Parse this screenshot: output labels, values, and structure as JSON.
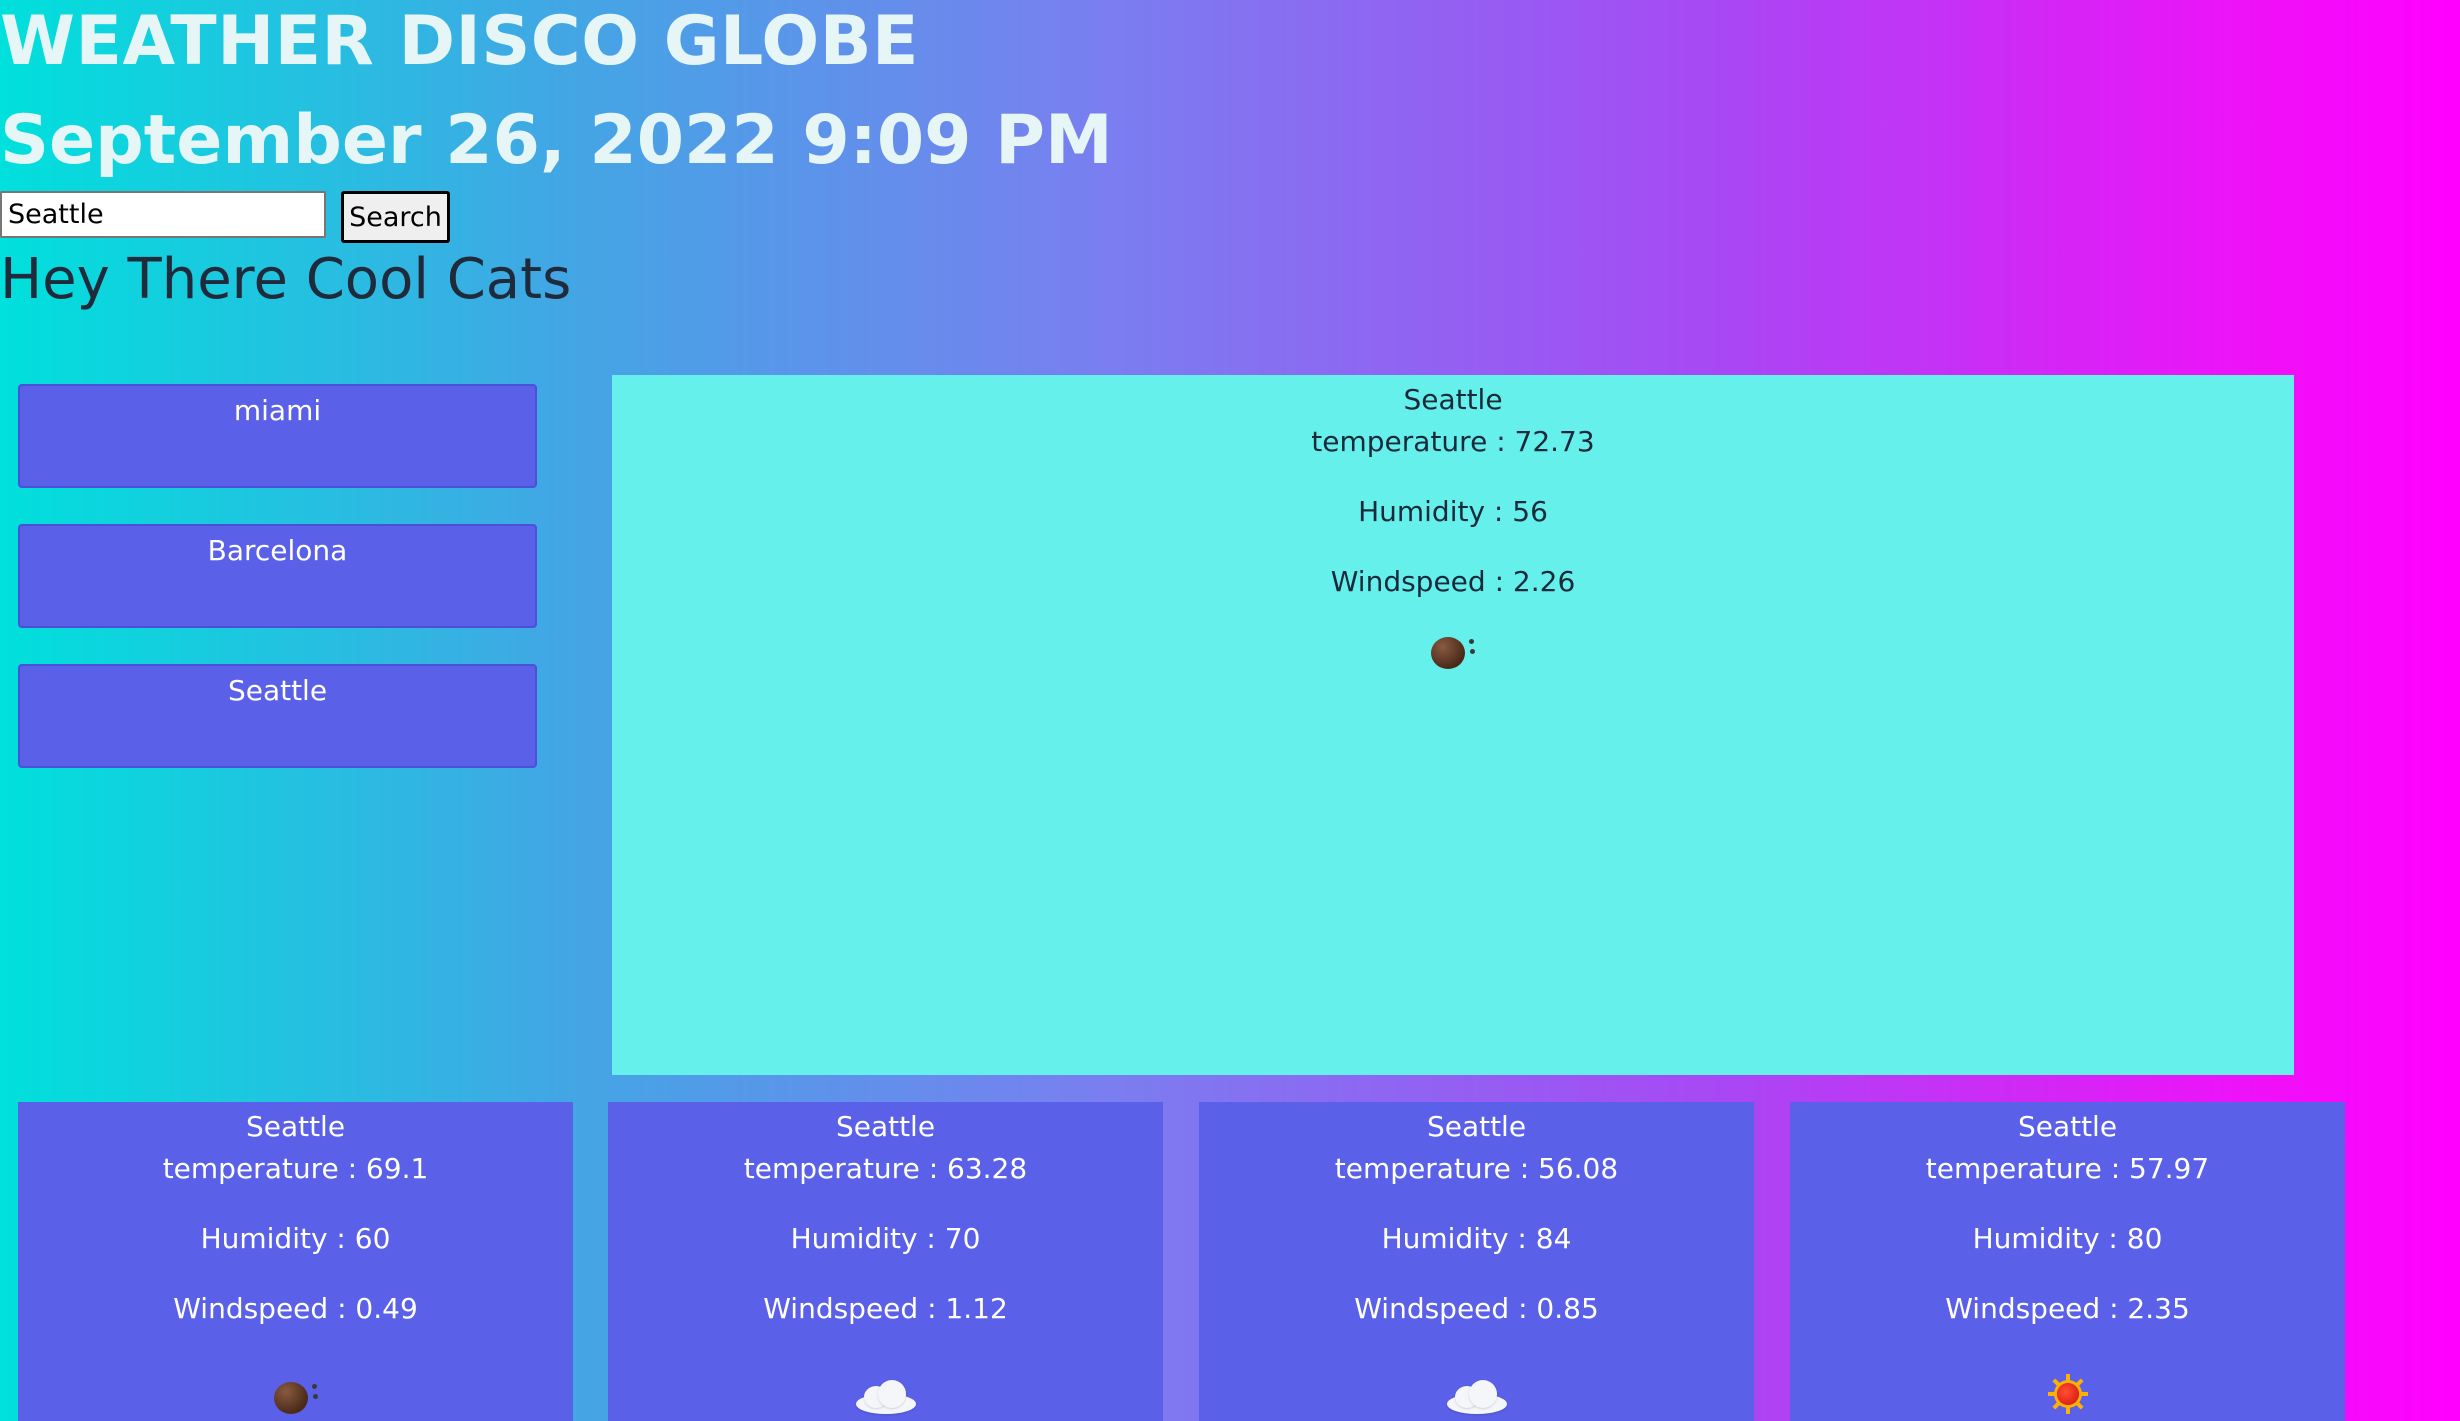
{
  "header": {
    "title": "WEATHER DISCO GLOBE",
    "datetime": "September 26, 2022 9:09 PM"
  },
  "search": {
    "value": "Seattle",
    "button_label": "Search"
  },
  "greeting": "Hey There Cool Cats",
  "history": [
    {
      "label": "miami"
    },
    {
      "label": "Barcelona"
    },
    {
      "label": "Seattle"
    }
  ],
  "current": {
    "city": "Seattle",
    "temperature": "temperature : 72.73",
    "humidity": "Humidity : 56",
    "windspeed": "Windspeed : 2.26",
    "icon": "bomb-icon"
  },
  "forecast": [
    {
      "city": "Seattle",
      "temperature": "temperature : 69.1",
      "humidity": "Humidity : 60",
      "windspeed": "Windspeed : 0.49",
      "icon": "bomb-icon"
    },
    {
      "city": "Seattle",
      "temperature": "temperature : 63.28",
      "humidity": "Humidity : 70",
      "windspeed": "Windspeed : 1.12",
      "icon": "cloud-icon"
    },
    {
      "city": "Seattle",
      "temperature": "temperature : 56.08",
      "humidity": "Humidity : 84",
      "windspeed": "Windspeed : 0.85",
      "icon": "cloud-icon"
    },
    {
      "city": "Seattle",
      "temperature": "temperature : 57.97",
      "humidity": "Humidity : 80",
      "windspeed": "Windspeed : 2.35",
      "icon": "sun-icon"
    }
  ],
  "colors": {
    "card": "#5a60e8",
    "current_card": "#66f0ec"
  }
}
